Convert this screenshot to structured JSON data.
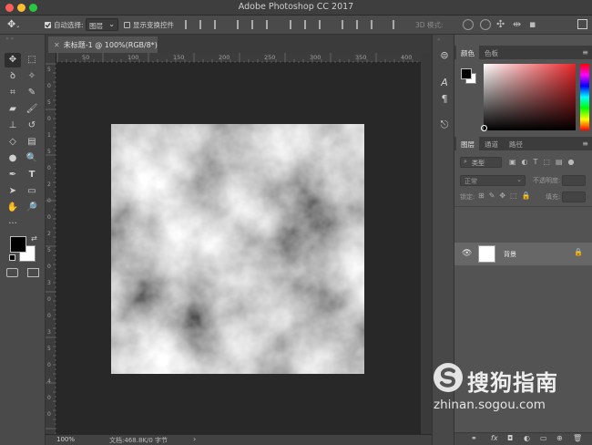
{
  "window": {
    "title": "Adobe Photoshop CC 2017",
    "traffic_lights": [
      "#fc5f57",
      "#fdbc2e",
      "#28c840"
    ]
  },
  "options_bar": {
    "auto_select_label": "自动选择:",
    "auto_select_value": "图层",
    "show_transform_label": "显示变换控件",
    "mode_3d_label": "3D 模式:"
  },
  "document": {
    "tab_label": "未标题-1 @ 100%(RGB/8*)",
    "ruler_h": [
      "50",
      "100",
      "150",
      "200",
      "250",
      "300",
      "350",
      "400",
      "450"
    ],
    "ruler_v": [
      "5",
      "0",
      "5",
      "0",
      "1",
      "5",
      "0",
      "2",
      "0",
      "0",
      "2",
      "5",
      "0",
      "3",
      "0",
      "0",
      "3",
      "5",
      "0",
      "4",
      "0",
      "0"
    ],
    "canvas_fill": "clouds filter (grayscale)"
  },
  "status_bar": {
    "zoom": "100%",
    "doc_info": "文档:468.8K/0 字节"
  },
  "panels": {
    "color_tabs": [
      "颜色",
      "色板"
    ],
    "layers_tabs": [
      "图层",
      "通道",
      "路径"
    ],
    "kind_filter": "类型",
    "blend_mode": "正常",
    "opacity_label": "不透明度:",
    "lock_label": "锁定:",
    "fill_label": "填充:",
    "layers": [
      {
        "name": "背景"
      }
    ]
  },
  "watermark": {
    "brand": "搜狗指南",
    "url": "zhinan.sogou.com"
  },
  "colors": {
    "foreground": "#000000",
    "background": "#ffffff",
    "ui_dark": "#282828",
    "ui_panel": "#535353"
  }
}
